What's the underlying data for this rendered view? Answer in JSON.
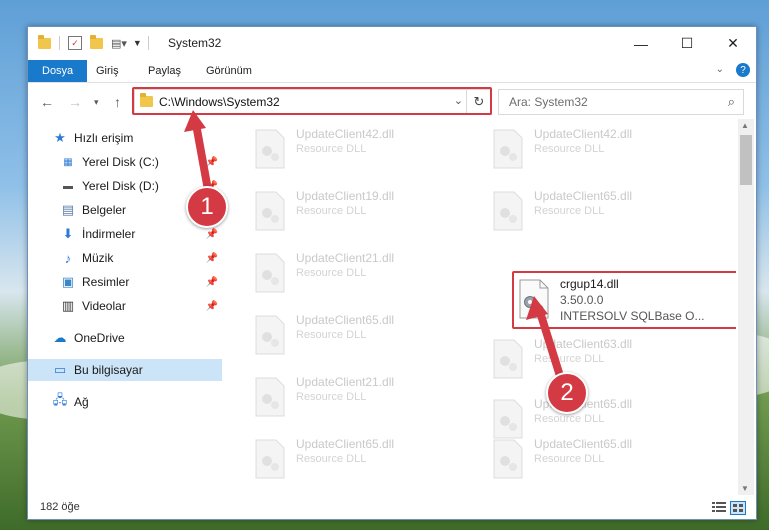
{
  "window": {
    "title": "System32",
    "controls": {
      "minimize": "—",
      "maximize": "☐",
      "close": "✕"
    }
  },
  "ribbon": {
    "tabs": [
      {
        "label": "Dosya",
        "active": true
      },
      {
        "label": "Giriş"
      },
      {
        "label": "Paylaş"
      },
      {
        "label": "Görünüm"
      }
    ]
  },
  "address": {
    "path": "C:\\Windows\\System32",
    "search_placeholder": "Ara: System32"
  },
  "nav": {
    "quick_access": "Hızlı erişim",
    "items": [
      {
        "label": "Yerel Disk (C:)",
        "icon": "drive-c-icon",
        "pinned": true
      },
      {
        "label": "Yerel Disk (D:)",
        "icon": "drive-d-icon",
        "pinned": true
      },
      {
        "label": "Belgeler",
        "icon": "documents-icon",
        "pinned": true
      },
      {
        "label": "İndirmeler",
        "icon": "downloads-icon",
        "pinned": true
      },
      {
        "label": "Müzik",
        "icon": "music-icon",
        "pinned": true
      },
      {
        "label": "Resimler",
        "icon": "pictures-icon",
        "pinned": true
      },
      {
        "label": "Videolar",
        "icon": "videos-icon",
        "pinned": true
      }
    ],
    "onedrive": "OneDrive",
    "this_pc": "Bu bilgisayar",
    "network": "Ağ"
  },
  "files": {
    "left": [
      {
        "name": "UpdateClient42.dll",
        "desc": "Resource DLL"
      },
      {
        "name": "UpdateClient19.dll",
        "desc": "Resource DLL"
      },
      {
        "name": "UpdateClient21.dll",
        "desc": "Resource DLL"
      },
      {
        "name": "UpdateClient65.dll",
        "desc": "Resource DLL"
      },
      {
        "name": "UpdateClient21.dll",
        "desc": "Resource DLL"
      },
      {
        "name": "UpdateClient65.dll",
        "desc": "Resource DLL"
      }
    ],
    "right": [
      {
        "name": "UpdateClient42.dll",
        "desc": "Resource DLL"
      },
      {
        "name": "UpdateClient65.dll",
        "desc": "Resource DLL"
      },
      {
        "name": "UpdateClient63.dll",
        "desc": "Resource DLL"
      },
      {
        "name": "UpdateClient65.dll",
        "desc": "Resource DLL"
      },
      {
        "name": "UpdateClient65.dll",
        "desc": "Resource DLL"
      }
    ],
    "highlighted": {
      "name": "crgup14.dll",
      "version": "3.50.0.0",
      "company": "INTERSOLV SQLBase O..."
    }
  },
  "status": {
    "count": "182 öğe"
  },
  "callouts": {
    "one": "1",
    "two": "2"
  },
  "colors": {
    "accent": "#1979ca",
    "highlight": "#d33a44",
    "selection": "#cce4f7"
  }
}
